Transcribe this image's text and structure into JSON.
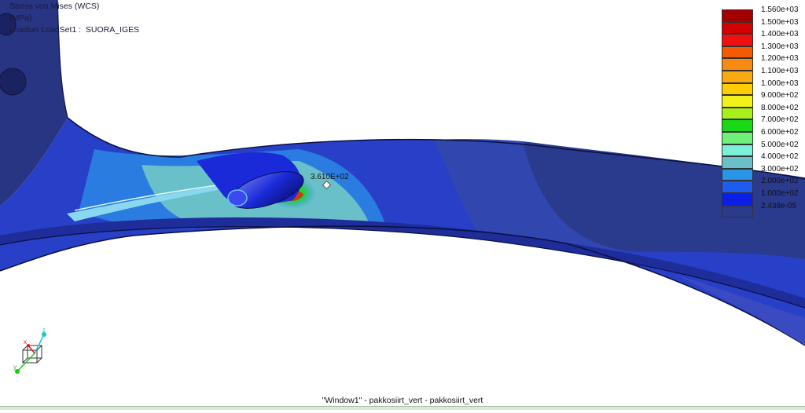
{
  "header": {
    "result_title": "Stress von Mises (WCS)",
    "units": "(MPa)",
    "loadset": "Loadset LoadSet1 :  SUORA_IGES"
  },
  "legend": {
    "entries": [
      {
        "label": "1.560e+03",
        "color": "#a50000"
      },
      {
        "label": "1.500e+03",
        "color": "#d40000"
      },
      {
        "label": "1.400e+03",
        "color": "#f01010"
      },
      {
        "label": "1.300e+03",
        "color": "#f55a00"
      },
      {
        "label": "1.200e+03",
        "color": "#f78a10"
      },
      {
        "label": "1.100e+03",
        "color": "#f8aa10"
      },
      {
        "label": "1.000e+03",
        "color": "#ffcc00"
      },
      {
        "label": "9.000e+02",
        "color": "#f2f21a"
      },
      {
        "label": "8.000e+02",
        "color": "#a8f01a"
      },
      {
        "label": "7.000e+02",
        "color": "#18d818"
      },
      {
        "label": "6.000e+02",
        "color": "#6ef07a"
      },
      {
        "label": "5.000e+02",
        "color": "#7af0d8"
      },
      {
        "label": "4.000e+02",
        "color": "#6ac0c8"
      },
      {
        "label": "3.000e+02",
        "color": "#2a94e6"
      },
      {
        "label": "2.000e+02",
        "color": "#1e5cf0"
      },
      {
        "label": "1.000e+02",
        "color": "#0a1ee6"
      },
      {
        "label": "2.438e-05",
        "color": "#2a3a8c"
      }
    ]
  },
  "probe": {
    "value": "3.610E+02"
  },
  "axes_triad": {
    "labels": [
      "z",
      "y",
      "x"
    ]
  },
  "window_title": "\"Window1\" - pakkosiirt_vert - pakkosiirt_vert"
}
